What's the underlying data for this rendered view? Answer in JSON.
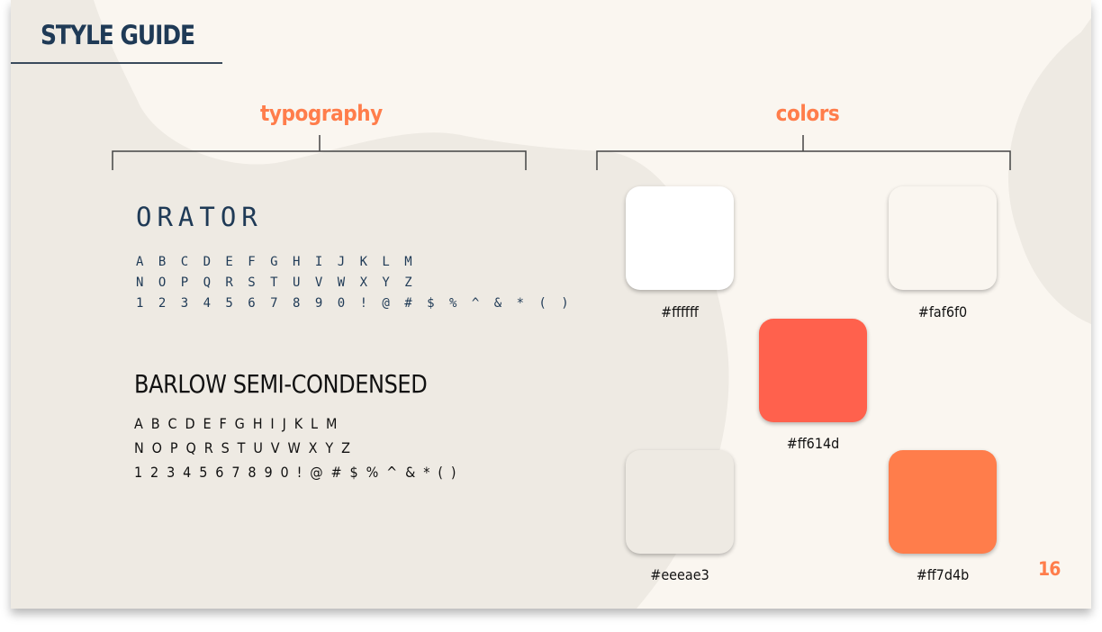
{
  "slide": {
    "title": "STYLE GUIDE",
    "page_number": "16",
    "background_color": "#eeeae3",
    "blob_color": "#faf6f0",
    "accent_color": "#ff7d4b",
    "title_color": "#1f3a56"
  },
  "typography": {
    "label": "typography",
    "orator": {
      "name": "ORATOR",
      "lines": [
        "A B C D E F G H I J K L M",
        "N O P Q R S T U V W X Y Z",
        "1 2 3 4 5 6 7 8 9 0 ! @ # $ % ^ & * ( )"
      ]
    },
    "barlow": {
      "name": "BARLOW SEMI-CONDENSED",
      "lines": [
        "A B C D E F G H I J K L M",
        "N O P Q R S T U V W X Y Z",
        "1 2 3 4 5 6 7 8 9 0 ! @ # $ % ^ & * ( )"
      ]
    }
  },
  "colors": {
    "label": "colors",
    "swatches": [
      {
        "hex": "#ffffff",
        "label": "#ffffff"
      },
      {
        "hex": "#faf6f0",
        "label": "#faf6f0"
      },
      {
        "hex": "#ff614d",
        "label": "#ff614d"
      },
      {
        "hex": "#eeeae3",
        "label": "#eeeae3"
      },
      {
        "hex": "#ff7d4b",
        "label": "#ff7d4b"
      }
    ]
  }
}
